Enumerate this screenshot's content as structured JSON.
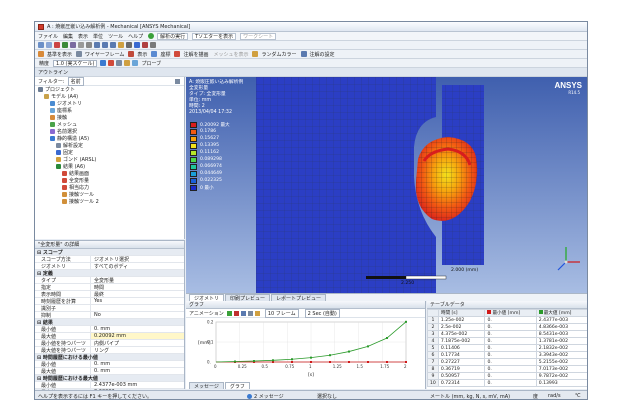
{
  "window": {
    "title": "A : 焼嵌圧嵌い込み解析例 - Mechanical [ANSYS Mechanical]"
  },
  "menu": {
    "items": [
      "ファイル",
      "編集",
      "表示",
      "単位",
      "ツール",
      "ヘルプ"
    ],
    "solve_label": "解析の実行",
    "show_results_label": "Tソエターを表示",
    "worksheet_label": "ワークシート"
  },
  "toolbar2": {
    "labels": [
      "製表を選択"
    ]
  },
  "toolbar3": {
    "deformed_label": "基準を表示",
    "wireframe_label": "ワイヤーフレーム",
    "edges_label": "表示",
    "coloring_label": "座標",
    "max_label": "注解を描画",
    "mesh_label": "メッシュを表示",
    "random_color_label": "ランダムカラー",
    "annotation_label": "注解の設定"
  },
  "toolbar4": {
    "scale_label": "精度",
    "scale_value": "1.0 (実スケール)",
    "probe_label": "プローブ"
  },
  "outline": {
    "header": "アウトライン",
    "filter_label": "フィルター:",
    "filter_value": "名前",
    "tree": [
      {
        "label": "プロジェクト",
        "depth": 0,
        "color": "#6b7c93"
      },
      {
        "label": "モデル (A4)",
        "depth": 1,
        "color": "#c9a24a"
      },
      {
        "label": "ジオメトリ",
        "depth": 2,
        "color": "#4a8bd1"
      },
      {
        "label": "座標系",
        "depth": 2,
        "color": "#6aa5d8"
      },
      {
        "label": "接触",
        "depth": 2,
        "color": "#d68a3a"
      },
      {
        "label": "メッシュ",
        "depth": 2,
        "color": "#4aa34a"
      },
      {
        "label": "名前選択",
        "depth": 2,
        "color": "#8a6ad1"
      },
      {
        "label": "静的構造 (A5)",
        "depth": 2,
        "color": "#3a7ad1"
      },
      {
        "label": "解析設定",
        "depth": 3,
        "color": "#7a8aa0"
      },
      {
        "label": "固定",
        "depth": 3,
        "color": "#3a6ad1"
      },
      {
        "label": "ゴンド (ARSL)",
        "depth": 3,
        "color": "#d1a03a"
      },
      {
        "label": "結果 (A6)",
        "depth": 3,
        "color": "#2a8a3a"
      },
      {
        "label": "結果画面",
        "depth": 4,
        "color": "#d14a3a"
      },
      {
        "label": "全変形量",
        "depth": 4,
        "color": "#d14a3a"
      },
      {
        "label": "相当応力",
        "depth": 4,
        "color": "#d14a3a"
      },
      {
        "label": "接触ツール",
        "depth": 4,
        "color": "#d1903a"
      },
      {
        "label": "接触ツール 2",
        "depth": 4,
        "color": "#d1903a"
      }
    ]
  },
  "details": {
    "header": "\"全変形量\" の詳細",
    "rows": [
      {
        "type": "sec",
        "k": "スコープ"
      },
      {
        "k": "スコープ方法",
        "v": "ジオメトリ選択"
      },
      {
        "k": "ジオメトリ",
        "v": "すべてのボディ"
      },
      {
        "type": "sec",
        "k": "定義"
      },
      {
        "k": "タイプ",
        "v": "全変形量"
      },
      {
        "k": "指定",
        "v": "時間"
      },
      {
        "k": "表示時間",
        "v": "最終"
      },
      {
        "k": "時刻履歴を計算",
        "v": "Yes"
      },
      {
        "k": "識別子",
        "v": ""
      },
      {
        "k": "抑制",
        "v": "No"
      },
      {
        "type": "sec",
        "k": "結果"
      },
      {
        "k": "最小値",
        "v": "0. mm"
      },
      {
        "k": "最大値",
        "v": "0.20092 mm",
        "hl": true
      },
      {
        "k": "最小値を持つパーツ",
        "v": "内側パイプ"
      },
      {
        "k": "最大値を持つパーツ",
        "v": "リング"
      },
      {
        "type": "sec",
        "k": "時間履歴における最小値"
      },
      {
        "k": "最小値",
        "v": "0. mm"
      },
      {
        "k": "最大値",
        "v": "0. mm"
      },
      {
        "type": "sec",
        "k": "時間履歴における最大値"
      },
      {
        "k": "最小値",
        "v": "2.4377e-003 mm"
      },
      {
        "k": "最大値",
        "v": "0.20092 mm"
      }
    ]
  },
  "viewport": {
    "info_lines": [
      "A: 焼嵌圧嵌い込み解析例",
      "全変形量",
      "タイプ: 全変形量",
      "単位: mm",
      "時間: 2",
      "2013/04/04 17:32"
    ],
    "legend": [
      {
        "label": "0.20092 最大",
        "color": "#d81d1d"
      },
      {
        "label": "0.1786",
        "color": "#f25a12"
      },
      {
        "label": "0.15627",
        "color": "#f7a30d"
      },
      {
        "label": "0.13395",
        "color": "#f2e21c"
      },
      {
        "label": "0.11162",
        "color": "#b6e62a"
      },
      {
        "label": "0.089298",
        "color": "#4fd94a"
      },
      {
        "label": "0.066974",
        "color": "#1ec69a"
      },
      {
        "label": "0.044649",
        "color": "#1a9fd8"
      },
      {
        "label": "0.022325",
        "color": "#1a5fd8"
      },
      {
        "label": "0 最小",
        "color": "#1a2bc9"
      }
    ],
    "logo": "ANSYS",
    "logo_version": "R14.5",
    "scale_label": "2.000 (mm)",
    "scale_value": "2.250",
    "tabs": [
      "ジオメトリ",
      "印刷プレビュー",
      "レポートプレビュー"
    ]
  },
  "graph": {
    "header": "グラフ",
    "animation_label": "アニメーション",
    "frames_label": "10 フレーム",
    "duration_label": "2 Sec (自動)",
    "bottom_tabs": [
      "メッセージ",
      "グラフ"
    ]
  },
  "chart_data": {
    "type": "line",
    "x": [
      0.2,
      0.4,
      0.6,
      0.8,
      1.0,
      1.2,
      1.4,
      1.6,
      1.8,
      2.0
    ],
    "series": [
      {
        "values": [
          0.0,
          0.0,
          0.0,
          0.0,
          0.0,
          0.0,
          0.0,
          0.0,
          0.0,
          0.0
        ],
        "color": "#d01818"
      },
      {
        "values": [
          0.0024377,
          0.0048366,
          0.0085431,
          0.013781,
          0.021832,
          0.033943,
          0.052155,
          0.078173,
          0.12,
          0.20092
        ],
        "color": "#2a9a2a"
      }
    ],
    "title": "",
    "xlabel": "[s]",
    "ylabel": "[mm]",
    "ylim": [
      0,
      0.2
    ],
    "xlim": [
      0,
      2
    ],
    "x_ticks": [
      "0",
      "0.25",
      "0.5",
      "0.75",
      "1",
      "1.25",
      "1.5",
      "1.75",
      "2"
    ],
    "y_ticks": [
      "0.",
      "0.1",
      "0.2"
    ]
  },
  "tabular": {
    "header": "テーブルデータ",
    "columns": [
      "時間 [s]",
      "最小値 [mm]",
      "最大値 [mm]"
    ],
    "rows": [
      {
        "n": "1",
        "t": "1.25e-002",
        "min": "0.",
        "max": "2.4377e-003"
      },
      {
        "n": "2",
        "t": "2.5e-002",
        "min": "0.",
        "max": "4.8366e-003"
      },
      {
        "n": "3",
        "t": "4.375e-002",
        "min": "0.",
        "max": "8.5431e-003"
      },
      {
        "n": "4",
        "t": "7.1875e-002",
        "min": "0.",
        "max": "1.3781e-002"
      },
      {
        "n": "5",
        "t": "0.11406",
        "min": "0.",
        "max": "2.1832e-002"
      },
      {
        "n": "6",
        "t": "0.17734",
        "min": "0.",
        "max": "3.3943e-002"
      },
      {
        "n": "7",
        "t": "0.27227",
        "min": "0.",
        "max": "5.2155e-002"
      },
      {
        "n": "8",
        "t": "0.36719",
        "min": "0.",
        "max": "7.0173e-002"
      },
      {
        "n": "9",
        "t": "0.50957",
        "min": "0.",
        "max": "9.7872e-002"
      },
      {
        "n": "10",
        "t": "0.72314",
        "min": "0.",
        "max": "0.13993"
      }
    ]
  },
  "status": {
    "help": "ヘルプを表示するには F1 キーを押してください。",
    "messages": "2 メッセージ",
    "selection": "選択なし",
    "units": "メートル (mm, kg, N, s, mV, mA)",
    "angle": "度",
    "rad": "rad/s",
    "temp": "℃"
  }
}
